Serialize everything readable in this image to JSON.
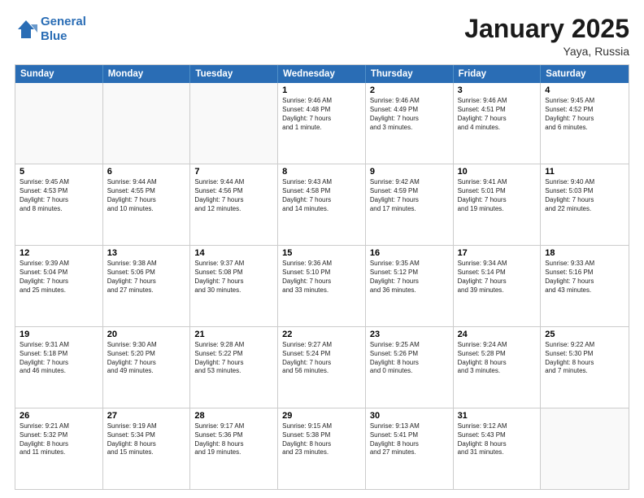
{
  "logo": {
    "line1": "General",
    "line2": "Blue"
  },
  "title": "January 2025",
  "location": "Yaya, Russia",
  "header_days": [
    "Sunday",
    "Monday",
    "Tuesday",
    "Wednesday",
    "Thursday",
    "Friday",
    "Saturday"
  ],
  "rows": [
    [
      {
        "day": "",
        "text": "",
        "empty": true
      },
      {
        "day": "",
        "text": "",
        "empty": true
      },
      {
        "day": "",
        "text": "",
        "empty": true
      },
      {
        "day": "1",
        "text": "Sunrise: 9:46 AM\nSunset: 4:48 PM\nDaylight: 7 hours\nand 1 minute."
      },
      {
        "day": "2",
        "text": "Sunrise: 9:46 AM\nSunset: 4:49 PM\nDaylight: 7 hours\nand 3 minutes."
      },
      {
        "day": "3",
        "text": "Sunrise: 9:46 AM\nSunset: 4:51 PM\nDaylight: 7 hours\nand 4 minutes."
      },
      {
        "day": "4",
        "text": "Sunrise: 9:45 AM\nSunset: 4:52 PM\nDaylight: 7 hours\nand 6 minutes."
      }
    ],
    [
      {
        "day": "5",
        "text": "Sunrise: 9:45 AM\nSunset: 4:53 PM\nDaylight: 7 hours\nand 8 minutes."
      },
      {
        "day": "6",
        "text": "Sunrise: 9:44 AM\nSunset: 4:55 PM\nDaylight: 7 hours\nand 10 minutes."
      },
      {
        "day": "7",
        "text": "Sunrise: 9:44 AM\nSunset: 4:56 PM\nDaylight: 7 hours\nand 12 minutes."
      },
      {
        "day": "8",
        "text": "Sunrise: 9:43 AM\nSunset: 4:58 PM\nDaylight: 7 hours\nand 14 minutes."
      },
      {
        "day": "9",
        "text": "Sunrise: 9:42 AM\nSunset: 4:59 PM\nDaylight: 7 hours\nand 17 minutes."
      },
      {
        "day": "10",
        "text": "Sunrise: 9:41 AM\nSunset: 5:01 PM\nDaylight: 7 hours\nand 19 minutes."
      },
      {
        "day": "11",
        "text": "Sunrise: 9:40 AM\nSunset: 5:03 PM\nDaylight: 7 hours\nand 22 minutes."
      }
    ],
    [
      {
        "day": "12",
        "text": "Sunrise: 9:39 AM\nSunset: 5:04 PM\nDaylight: 7 hours\nand 25 minutes."
      },
      {
        "day": "13",
        "text": "Sunrise: 9:38 AM\nSunset: 5:06 PM\nDaylight: 7 hours\nand 27 minutes."
      },
      {
        "day": "14",
        "text": "Sunrise: 9:37 AM\nSunset: 5:08 PM\nDaylight: 7 hours\nand 30 minutes."
      },
      {
        "day": "15",
        "text": "Sunrise: 9:36 AM\nSunset: 5:10 PM\nDaylight: 7 hours\nand 33 minutes."
      },
      {
        "day": "16",
        "text": "Sunrise: 9:35 AM\nSunset: 5:12 PM\nDaylight: 7 hours\nand 36 minutes."
      },
      {
        "day": "17",
        "text": "Sunrise: 9:34 AM\nSunset: 5:14 PM\nDaylight: 7 hours\nand 39 minutes."
      },
      {
        "day": "18",
        "text": "Sunrise: 9:33 AM\nSunset: 5:16 PM\nDaylight: 7 hours\nand 43 minutes."
      }
    ],
    [
      {
        "day": "19",
        "text": "Sunrise: 9:31 AM\nSunset: 5:18 PM\nDaylight: 7 hours\nand 46 minutes."
      },
      {
        "day": "20",
        "text": "Sunrise: 9:30 AM\nSunset: 5:20 PM\nDaylight: 7 hours\nand 49 minutes."
      },
      {
        "day": "21",
        "text": "Sunrise: 9:28 AM\nSunset: 5:22 PM\nDaylight: 7 hours\nand 53 minutes."
      },
      {
        "day": "22",
        "text": "Sunrise: 9:27 AM\nSunset: 5:24 PM\nDaylight: 7 hours\nand 56 minutes."
      },
      {
        "day": "23",
        "text": "Sunrise: 9:25 AM\nSunset: 5:26 PM\nDaylight: 8 hours\nand 0 minutes."
      },
      {
        "day": "24",
        "text": "Sunrise: 9:24 AM\nSunset: 5:28 PM\nDaylight: 8 hours\nand 3 minutes."
      },
      {
        "day": "25",
        "text": "Sunrise: 9:22 AM\nSunset: 5:30 PM\nDaylight: 8 hours\nand 7 minutes."
      }
    ],
    [
      {
        "day": "26",
        "text": "Sunrise: 9:21 AM\nSunset: 5:32 PM\nDaylight: 8 hours\nand 11 minutes."
      },
      {
        "day": "27",
        "text": "Sunrise: 9:19 AM\nSunset: 5:34 PM\nDaylight: 8 hours\nand 15 minutes."
      },
      {
        "day": "28",
        "text": "Sunrise: 9:17 AM\nSunset: 5:36 PM\nDaylight: 8 hours\nand 19 minutes."
      },
      {
        "day": "29",
        "text": "Sunrise: 9:15 AM\nSunset: 5:38 PM\nDaylight: 8 hours\nand 23 minutes."
      },
      {
        "day": "30",
        "text": "Sunrise: 9:13 AM\nSunset: 5:41 PM\nDaylight: 8 hours\nand 27 minutes."
      },
      {
        "day": "31",
        "text": "Sunrise: 9:12 AM\nSunset: 5:43 PM\nDaylight: 8 hours\nand 31 minutes."
      },
      {
        "day": "",
        "text": "",
        "empty": true
      }
    ]
  ]
}
